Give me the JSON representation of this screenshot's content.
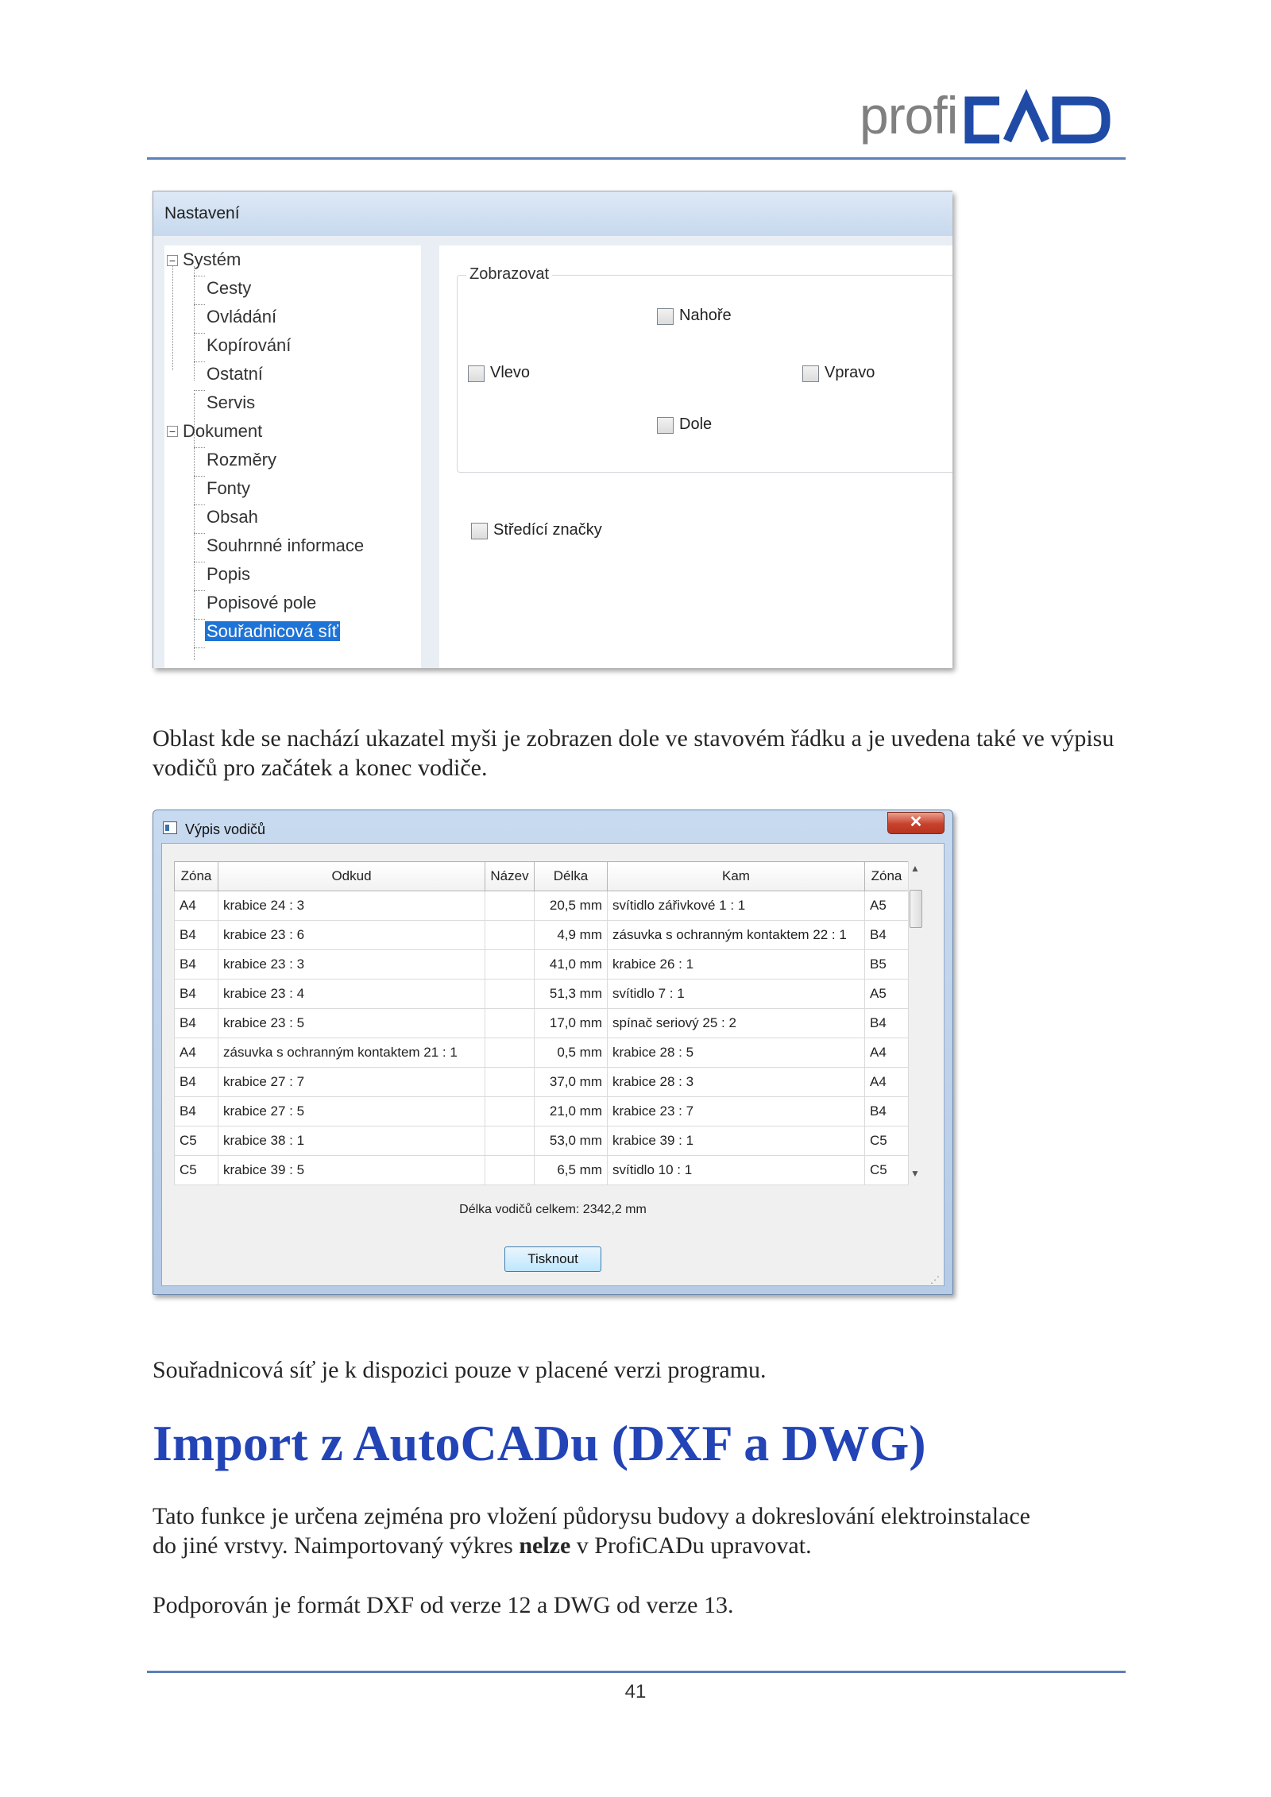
{
  "header": {
    "logo_text_light": "profi",
    "logo_text_bold": "CAD",
    "logo_colors": {
      "profi": "#808080",
      "cad": "#1f4ba6",
      "rule": "#5b7fb8"
    }
  },
  "settings_dialog": {
    "title": "Nastavení",
    "tree": [
      {
        "label": "Systém",
        "level": 0,
        "expander": "−"
      },
      {
        "label": "Cesty",
        "level": 1
      },
      {
        "label": "Ovládání",
        "level": 1
      },
      {
        "label": "Kopírování",
        "level": 1
      },
      {
        "label": "Ostatní",
        "level": 1
      },
      {
        "label": "Servis",
        "level": 1
      },
      {
        "label": "Dokument",
        "level": 0,
        "expander": "−"
      },
      {
        "label": "Rozměry",
        "level": 1
      },
      {
        "label": "Fonty",
        "level": 1
      },
      {
        "label": "Obsah",
        "level": 1
      },
      {
        "label": "Souhrnné informace",
        "level": 1
      },
      {
        "label": "Popis",
        "level": 1
      },
      {
        "label": "Popisové pole",
        "level": 1
      },
      {
        "label": "Souřadnicová síť",
        "level": 1,
        "selected": true
      }
    ],
    "group_label": "Zobrazovat",
    "checkboxes": {
      "top": "Nahoře",
      "left": "Vlevo",
      "right": "Vpravo",
      "bottom": "Dole",
      "center_marks": "Středící značky"
    }
  },
  "paragraph_1": "Oblast kde se nachází ukazatel myši je zobrazen dole ve stavovém řádku a je uvedena také ve výpisu vodičů pro začátek a konec vodiče.",
  "wire_dialog": {
    "title": "Výpis vodičů",
    "close_label": "✕",
    "columns": [
      "Zóna",
      "Odkud",
      "Název",
      "Délka",
      "Kam",
      "Zóna"
    ],
    "rows": [
      [
        "A4",
        "krabice 24 : 3",
        "",
        "20,5 mm",
        "svítidlo zářivkové 1 : 1",
        "A5"
      ],
      [
        "B4",
        "krabice 23 : 6",
        "",
        "4,9 mm",
        "zásuvka s ochranným kontaktem 22 : 1",
        "B4"
      ],
      [
        "B4",
        "krabice 23 : 3",
        "",
        "41,0 mm",
        "krabice 26 : 1",
        "B5"
      ],
      [
        "B4",
        "krabice 23 : 4",
        "",
        "51,3 mm",
        "svítidlo 7 : 1",
        "A5"
      ],
      [
        "B4",
        "krabice 23 : 5",
        "",
        "17,0 mm",
        "spínač seriový 25 : 2",
        "B4"
      ],
      [
        "A4",
        "zásuvka s ochranným kontaktem 21 : 1",
        "",
        "0,5 mm",
        "krabice 28 : 5",
        "A4"
      ],
      [
        "B4",
        "krabice 27 : 7",
        "",
        "37,0 mm",
        "krabice 28 : 3",
        "A4"
      ],
      [
        "B4",
        "krabice 27 : 5",
        "",
        "21,0 mm",
        "krabice 23 : 7",
        "B4"
      ],
      [
        "C5",
        "krabice 38 : 1",
        "",
        "53,0 mm",
        "krabice 39 : 1",
        "C5"
      ],
      [
        "C5",
        "krabice 39 : 5",
        "",
        "6,5 mm",
        "svítidlo 10 : 1",
        "C5"
      ]
    ],
    "total": "Délka vodičů celkem: 2342,2 mm",
    "print_button": "Tisknout"
  },
  "paragraph_2": "Souřadnicová síť je k dispozici pouze v placené verzi programu.",
  "heading": "Import z AutoCADu (DXF a DWG)",
  "paragraph_3": {
    "line_1": "Tato funkce je určena zejména pro vložení půdorysu budovy a dokreslování elektroinstalace",
    "line_2_before": "do jiné vrstvy. Naimportovaný výkres ",
    "line_2_bold": "nelze",
    "line_2_after": " v ProfiCADu upravovat."
  },
  "paragraph_4": "Podporován je formát DXF od verze 12 a DWG od verze 13.",
  "page_number": "41"
}
